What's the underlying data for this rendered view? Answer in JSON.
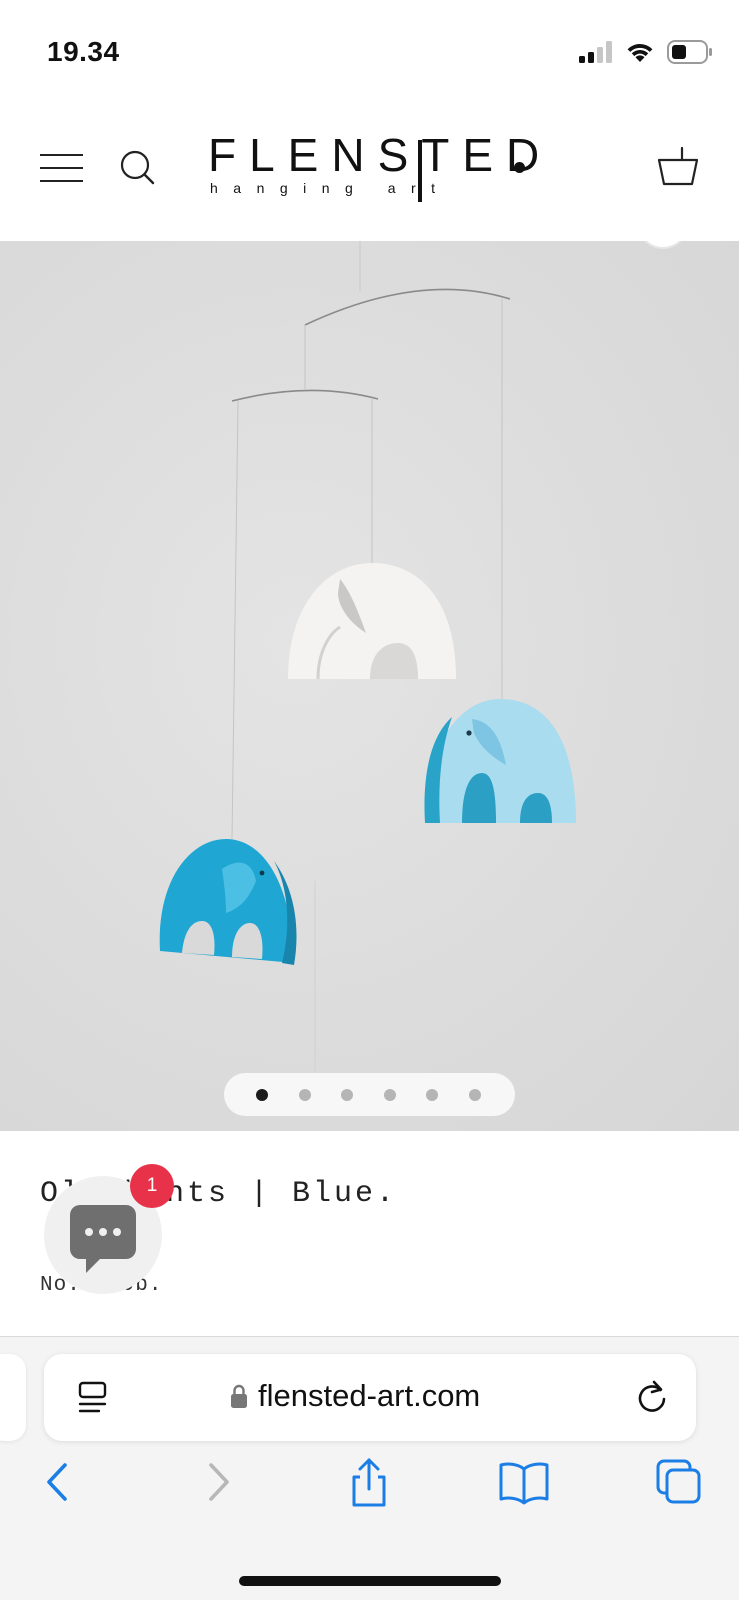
{
  "status_bar": {
    "time": "19.34",
    "icons": [
      "cellular-signal-icon",
      "wifi-icon",
      "battery-icon"
    ]
  },
  "header": {
    "logo_text": "FLENSTED",
    "logo_tagline": "hanging art",
    "icons": [
      "menu-icon",
      "search-icon",
      "cart-icon"
    ]
  },
  "gallery": {
    "image_alt": "Elephants hanging mobile in white and blue",
    "total_images": 6,
    "active_index": 0
  },
  "product": {
    "title": "Olephants | Blue.",
    "number": "No. 149b."
  },
  "chat": {
    "badge_count": "1",
    "icon": "chat-bubble-icon"
  },
  "browser": {
    "url": "flensted-art.com",
    "icons": [
      "reader-icon",
      "lock-icon",
      "reload-icon",
      "back-icon",
      "forward-icon",
      "share-icon",
      "bookmarks-icon",
      "tabs-icon"
    ]
  },
  "colors": {
    "accent_blue": "#1a7ee6",
    "badge_red": "#e8324a",
    "elephant_light_blue": "#a9dcef",
    "elephant_blue": "#1fa6d2"
  }
}
